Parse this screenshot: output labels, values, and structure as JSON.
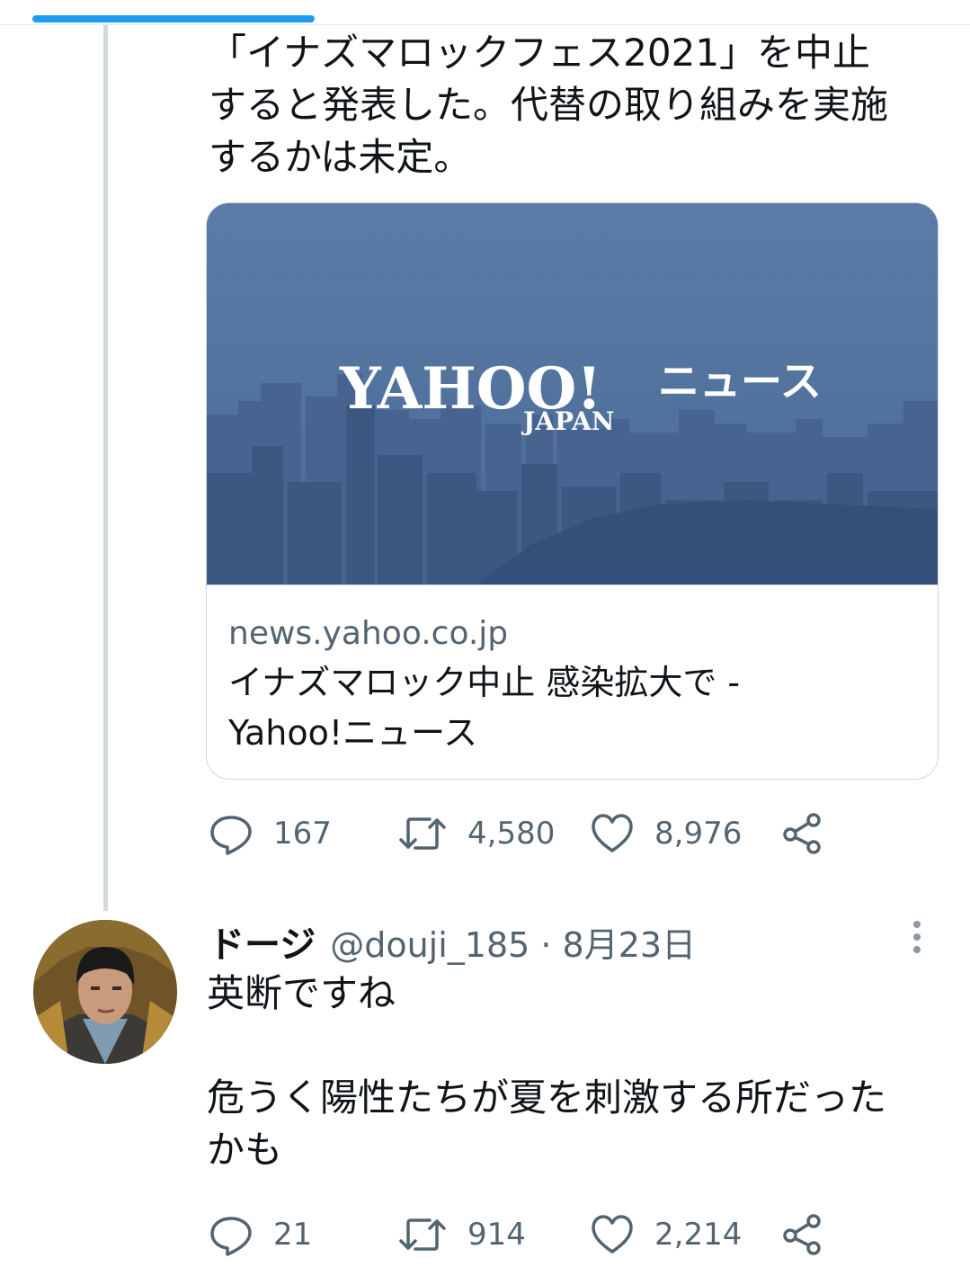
{
  "thread": {
    "tweet_text_lines": [
      "「イナズマロックフェス2021」を中止",
      "すると発表した。代替の取り組みを実施",
      "するかは未定。"
    ],
    "card": {
      "domain": "news.yahoo.co.jp",
      "title_lines": [
        "イナズマロック中止 感染拡大で -",
        "Yahoo!ニュース"
      ],
      "logo_main": "YAHOO!",
      "logo_sub": "JAPAN",
      "logo_news": "ニュース"
    },
    "actions": {
      "reply_count": "167",
      "retweet_count": "4,580",
      "like_count": "8,976"
    }
  },
  "reply": {
    "display_name": "ドージ",
    "handle_date": "@douji_185 · 8月23日",
    "text_lines": [
      "英断ですね",
      "",
      "危うく陽性たちが夏を刺激する所だった",
      "かも"
    ],
    "actions": {
      "reply_count": "21",
      "retweet_count": "914",
      "like_count": "2,214"
    }
  },
  "colors": {
    "accent": "#1d9bf0",
    "secondary_text": "#536471",
    "border": "#cfd9de"
  },
  "icons": [
    "reply-icon",
    "retweet-icon",
    "like-icon",
    "share-icon",
    "more-icon"
  ]
}
